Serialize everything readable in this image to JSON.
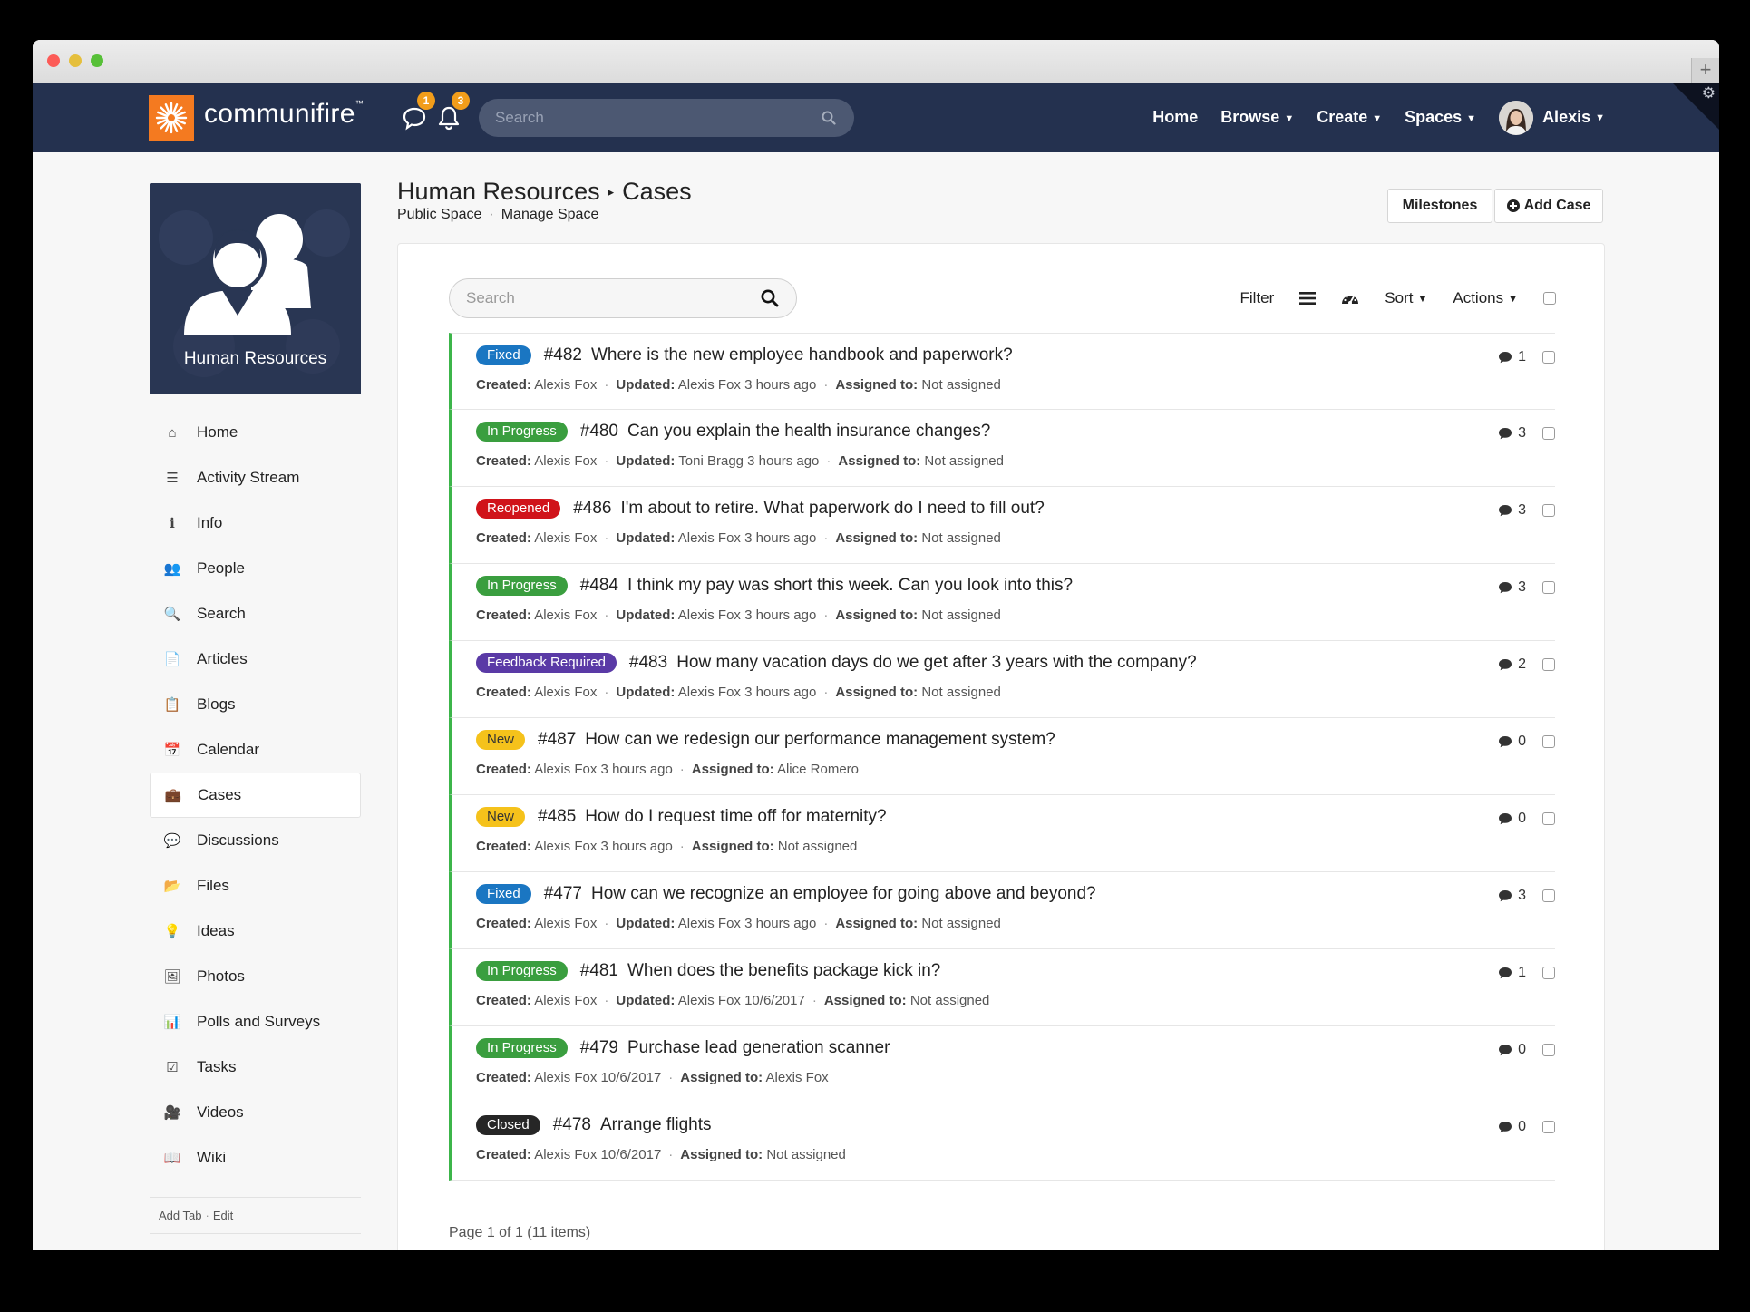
{
  "brand": {
    "name": "communifire",
    "trademark": "™"
  },
  "nav": {
    "messages_count": "1",
    "notifications_count": "3",
    "search_placeholder": "Search",
    "links": [
      {
        "label": "Home"
      },
      {
        "label": "Browse",
        "caret": "▼"
      },
      {
        "label": "Create",
        "caret": "▼"
      },
      {
        "label": "Spaces",
        "caret": "▼"
      }
    ],
    "user": {
      "name": "Alexis",
      "caret": "▼"
    }
  },
  "space": {
    "name": "Human Resources"
  },
  "sidebar": {
    "items": [
      {
        "label": "Home",
        "icon": "home-icon",
        "glyph": "⌂"
      },
      {
        "label": "Activity Stream",
        "icon": "list-icon",
        "glyph": "☰"
      },
      {
        "label": "Info",
        "icon": "info-icon",
        "glyph": "ℹ"
      },
      {
        "label": "People",
        "icon": "people-icon",
        "glyph": "👥"
      },
      {
        "label": "Search",
        "icon": "search-icon",
        "glyph": "🔍"
      },
      {
        "label": "Articles",
        "icon": "document-icon",
        "glyph": "📄"
      },
      {
        "label": "Blogs",
        "icon": "blog-icon",
        "glyph": "📋"
      },
      {
        "label": "Calendar",
        "icon": "calendar-icon",
        "glyph": "📅"
      },
      {
        "label": "Cases",
        "icon": "briefcase-icon",
        "glyph": "💼"
      },
      {
        "label": "Discussions",
        "icon": "chat-icon",
        "glyph": "💬"
      },
      {
        "label": "Files",
        "icon": "folder-icon",
        "glyph": "📂"
      },
      {
        "label": "Ideas",
        "icon": "lightbulb-icon",
        "glyph": "💡"
      },
      {
        "label": "Photos",
        "icon": "photo-icon",
        "glyph": "🖼"
      },
      {
        "label": "Polls and Surveys",
        "icon": "chart-icon",
        "glyph": "📊"
      },
      {
        "label": "Tasks",
        "icon": "check-icon",
        "glyph": "☑"
      },
      {
        "label": "Videos",
        "icon": "video-icon",
        "glyph": "🎥"
      },
      {
        "label": "Wiki",
        "icon": "book-icon",
        "glyph": "📖"
      }
    ],
    "active_index": 8,
    "footer": {
      "add_tab": "Add Tab",
      "sep": "·",
      "edit": "Edit"
    }
  },
  "page": {
    "title_space": "Human Resources",
    "title_sep": "▸",
    "title_section": "Cases",
    "sub_left": "Public Space",
    "sub_sep": "·",
    "sub_right": "Manage Space",
    "milestones_label": "Milestones",
    "add_case_label": "Add Case"
  },
  "list": {
    "search_placeholder": "Search",
    "filter_label": "Filter",
    "sort_label": "Sort",
    "actions_label": "Actions",
    "caret": "▼",
    "pager": "Page 1 of 1 (11 items)"
  },
  "labels": {
    "created": "Created:",
    "updated": "Updated:",
    "assigned": "Assigned to:"
  },
  "status_colors": {
    "Fixed": "#1a76c2",
    "In Progress": "#3a9e3f",
    "Reopened": "#d0131a",
    "Feedback Required": "#5a3aa6",
    "New": "#f5c21b",
    "Closed": "#262626"
  },
  "cases": [
    {
      "status": "Fixed",
      "num": "#482",
      "title": "Where is the new employee handbook and paperwork?",
      "created": "Alexis Fox",
      "updated": "Alexis Fox 3 hours ago",
      "assigned": "Not assigned",
      "comments": "1"
    },
    {
      "status": "In Progress",
      "num": "#480",
      "title": "Can you explain the health insurance changes?",
      "created": "Alexis Fox",
      "updated": "Toni Bragg 3 hours ago",
      "assigned": "Not assigned",
      "comments": "3"
    },
    {
      "status": "Reopened",
      "num": "#486",
      "title": "I'm about to retire. What paperwork do I need to fill out?",
      "created": "Alexis Fox",
      "updated": "Alexis Fox 3 hours ago",
      "assigned": "Not assigned",
      "comments": "3"
    },
    {
      "status": "In Progress",
      "num": "#484",
      "title": "I think my pay was short this week. Can you look into this?",
      "created": "Alexis Fox",
      "updated": "Alexis Fox 3 hours ago",
      "assigned": "Not assigned",
      "comments": "3"
    },
    {
      "status": "Feedback Required",
      "num": "#483",
      "title": "How many vacation days do we get after 3 years with the company?",
      "created": "Alexis Fox",
      "updated": "Alexis Fox 3 hours ago",
      "assigned": "Not assigned",
      "comments": "2"
    },
    {
      "status": "New",
      "num": "#487",
      "title": "How can we redesign our performance management system?",
      "created": "Alexis Fox 3 hours ago",
      "updated": "",
      "assigned": "Alice Romero",
      "comments": "0"
    },
    {
      "status": "New",
      "num": "#485",
      "title": "How do I request time off for maternity?",
      "created": "Alexis Fox 3 hours ago",
      "updated": "",
      "assigned": "Not assigned",
      "comments": "0"
    },
    {
      "status": "Fixed",
      "num": "#477",
      "title": "How can we recognize an employee for going above and beyond?",
      "created": "Alexis Fox",
      "updated": "Alexis Fox 3 hours ago",
      "assigned": "Not assigned",
      "comments": "3"
    },
    {
      "status": "In Progress",
      "num": "#481",
      "title": "When does the benefits package kick in?",
      "created": "Alexis Fox",
      "updated": "Alexis Fox 10/6/2017",
      "assigned": "Not assigned",
      "comments": "1"
    },
    {
      "status": "In Progress",
      "num": "#479",
      "title": "Purchase lead generation scanner",
      "created": "Alexis Fox 10/6/2017",
      "updated": "",
      "assigned": "Alexis Fox",
      "comments": "0"
    },
    {
      "status": "Closed",
      "num": "#478",
      "title": "Arrange flights",
      "created": "Alexis Fox 10/6/2017",
      "updated": "",
      "assigned": "Not assigned",
      "comments": "0"
    }
  ]
}
